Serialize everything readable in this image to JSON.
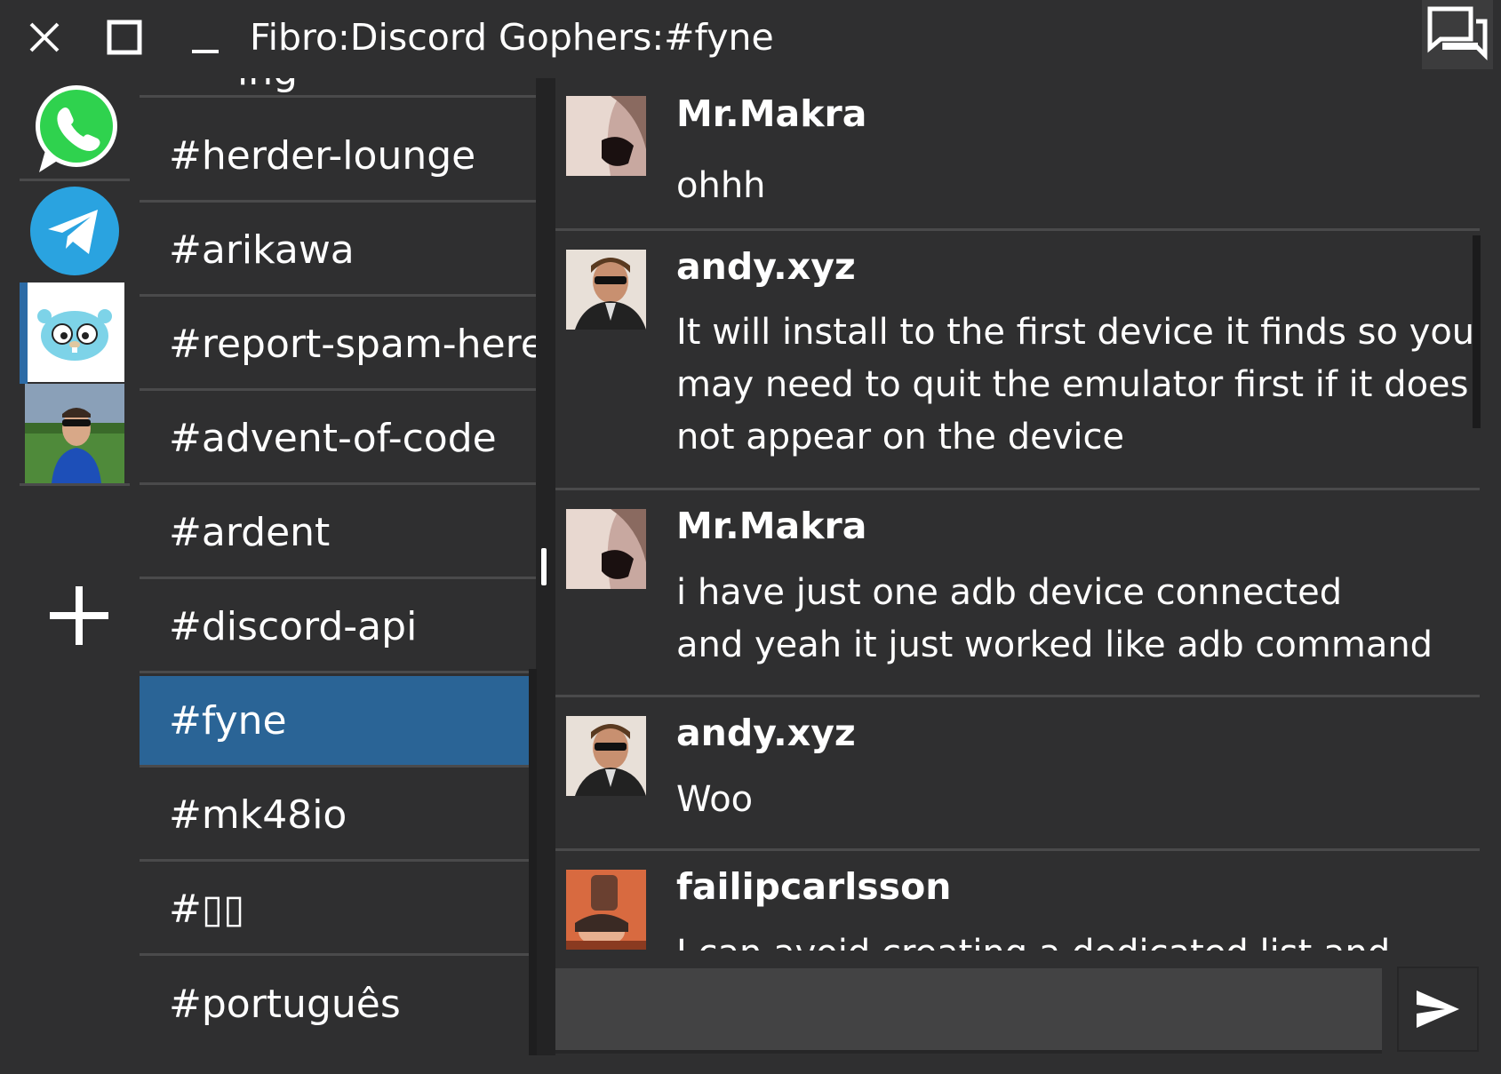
{
  "window": {
    "title": "Fibro:Discord Gophers:#fyne",
    "controls": [
      "close-icon",
      "maximize-icon",
      "minimize-icon"
    ],
    "chat_toggle_icon": "chat-bubbles-icon"
  },
  "accounts": [
    {
      "name": "WhatsApp",
      "icon": "whatsapp-icon",
      "color": "#2fd24e"
    },
    {
      "name": "Telegram",
      "icon": "telegram-icon",
      "color": "#2aa3e0"
    },
    {
      "name": "Discord Gophers",
      "icon": "gopher-icon",
      "active": true
    },
    {
      "name": "User account",
      "icon": "user-photo"
    }
  ],
  "add_account_icon": "plus-icon",
  "channels": {
    "partial_top": "ing",
    "items": [
      {
        "label": "#herder-lounge"
      },
      {
        "label": "#arikawa"
      },
      {
        "label": "#report-spam-here"
      },
      {
        "label": "#advent-of-code"
      },
      {
        "label": "#ardent"
      },
      {
        "label": "#discord-api"
      },
      {
        "label": "#fyne",
        "selected": true
      },
      {
        "label": "#mk48io"
      },
      {
        "label": "#▯▯"
      },
      {
        "label": "#português"
      }
    ]
  },
  "messages": [
    {
      "author": "Mr.Makra",
      "lines": [
        "ohhh"
      ]
    },
    {
      "author": "andy.xyz",
      "lines": [
        "It will install to the first device it finds so you",
        "may need to quit the emulator first if it does",
        "not appear on the device"
      ]
    },
    {
      "author": "Mr.Makra",
      "lines": [
        "i have just one adb device connected",
        "and yeah it just worked like adb command"
      ]
    },
    {
      "author": "andy.xyz",
      "lines": [
        "Woo"
      ]
    },
    {
      "author": "failipcarlsson",
      "lines": [
        "I can avoid creating a dedicated list and"
      ]
    }
  ],
  "composer": {
    "placeholder": "",
    "value": "",
    "send_icon": "send-icon"
  },
  "colors": {
    "background": "#2f2f30",
    "selected": "#2a6496",
    "separator": "#4a4a4b",
    "input": "#434344"
  }
}
